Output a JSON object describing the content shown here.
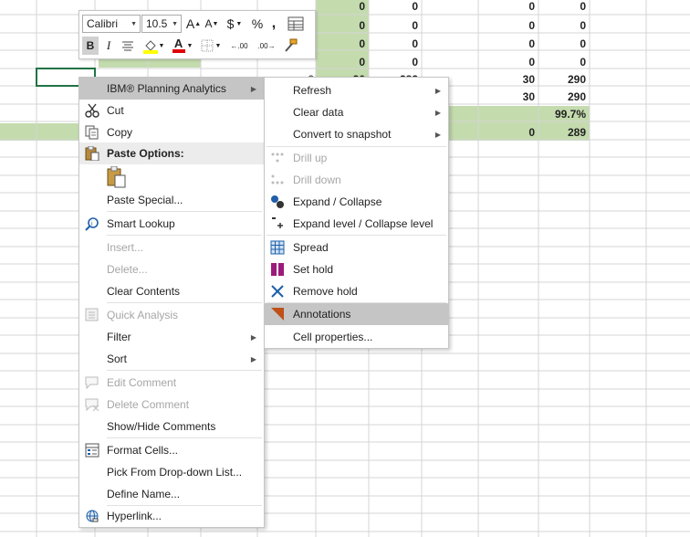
{
  "sheet": {
    "top_values": [
      "0",
      "0",
      "0",
      "0",
      "0",
      "0"
    ],
    "col_h": [
      "0",
      "0",
      "0",
      "0"
    ],
    "col_i": [
      "0",
      "0",
      "0",
      "0",
      "282"
    ],
    "col_k": [
      "0",
      "0",
      "0",
      "0",
      "30",
      "30",
      "",
      "0"
    ],
    "col_l": [
      "0",
      "0",
      "0",
      "0",
      "290",
      "290",
      "99.7%",
      "289"
    ],
    "col_g_row5": "0",
    "col_h_row5": "30"
  },
  "mini_toolbar": {
    "font_name": "Calibri",
    "font_size": "10.5",
    "grow_font": "A",
    "shrink_font": "A",
    "currency": "$",
    "percent": "%",
    "comma": ",",
    "bold": "B",
    "italic": "I",
    "font_color_letter": "A",
    "inc_decimal": ".00",
    "dec_decimal": ".00"
  },
  "context_menu": {
    "items": [
      {
        "label": "IBM® Planning Analytics",
        "icon": "none",
        "submenu": true,
        "highlighted": true
      },
      {
        "label": "Cut",
        "icon": "scissors-icon"
      },
      {
        "label": "Copy",
        "icon": "copy-icon"
      },
      {
        "label": "Paste Options:",
        "icon": "paste-icon",
        "header": true
      },
      {
        "label": "",
        "icon": "paste-clipboard-icon"
      },
      {
        "label": "Paste Special...",
        "icon": "none"
      },
      {
        "label": "Smart Lookup",
        "icon": "smart-lookup-icon"
      },
      {
        "label": "Insert...",
        "icon": "none",
        "disabled": true
      },
      {
        "label": "Delete...",
        "icon": "none",
        "disabled": true
      },
      {
        "label": "Clear Contents",
        "icon": "none"
      },
      {
        "label": "Quick Analysis",
        "icon": "quick-analysis-icon",
        "disabled": true
      },
      {
        "label": "Filter",
        "icon": "none",
        "submenu": true
      },
      {
        "label": "Sort",
        "icon": "none",
        "submenu": true
      },
      {
        "label": "Edit Comment",
        "icon": "edit-comment-icon",
        "disabled": true
      },
      {
        "label": "Delete Comment",
        "icon": "delete-comment-icon",
        "disabled": true
      },
      {
        "label": "Show/Hide Comments",
        "icon": "none"
      },
      {
        "label": "Format Cells...",
        "icon": "format-cells-icon"
      },
      {
        "label": "Pick From Drop-down List...",
        "icon": "none"
      },
      {
        "label": "Define Name...",
        "icon": "none"
      },
      {
        "label": "Hyperlink...",
        "icon": "hyperlink-icon"
      }
    ]
  },
  "submenu": {
    "items": [
      {
        "label": "Refresh",
        "submenu": true
      },
      {
        "label": "Clear data",
        "submenu": true
      },
      {
        "label": "Convert to snapshot",
        "submenu": true
      },
      {
        "label": "Drill up",
        "icon": "drill-up-icon",
        "disabled": true
      },
      {
        "label": "Drill down",
        "icon": "drill-down-icon",
        "disabled": true
      },
      {
        "label": "Expand / Collapse",
        "icon": "expand-collapse-icon"
      },
      {
        "label": "Expand level / Collapse level",
        "icon": "expand-level-icon"
      },
      {
        "label": "Spread",
        "icon": "spread-icon"
      },
      {
        "label": "Set hold",
        "icon": "set-hold-icon"
      },
      {
        "label": "Remove hold",
        "icon": "remove-hold-icon"
      },
      {
        "label": "Annotations",
        "icon": "annotations-icon",
        "highlighted": true
      },
      {
        "label": "Cell properties..."
      }
    ]
  }
}
